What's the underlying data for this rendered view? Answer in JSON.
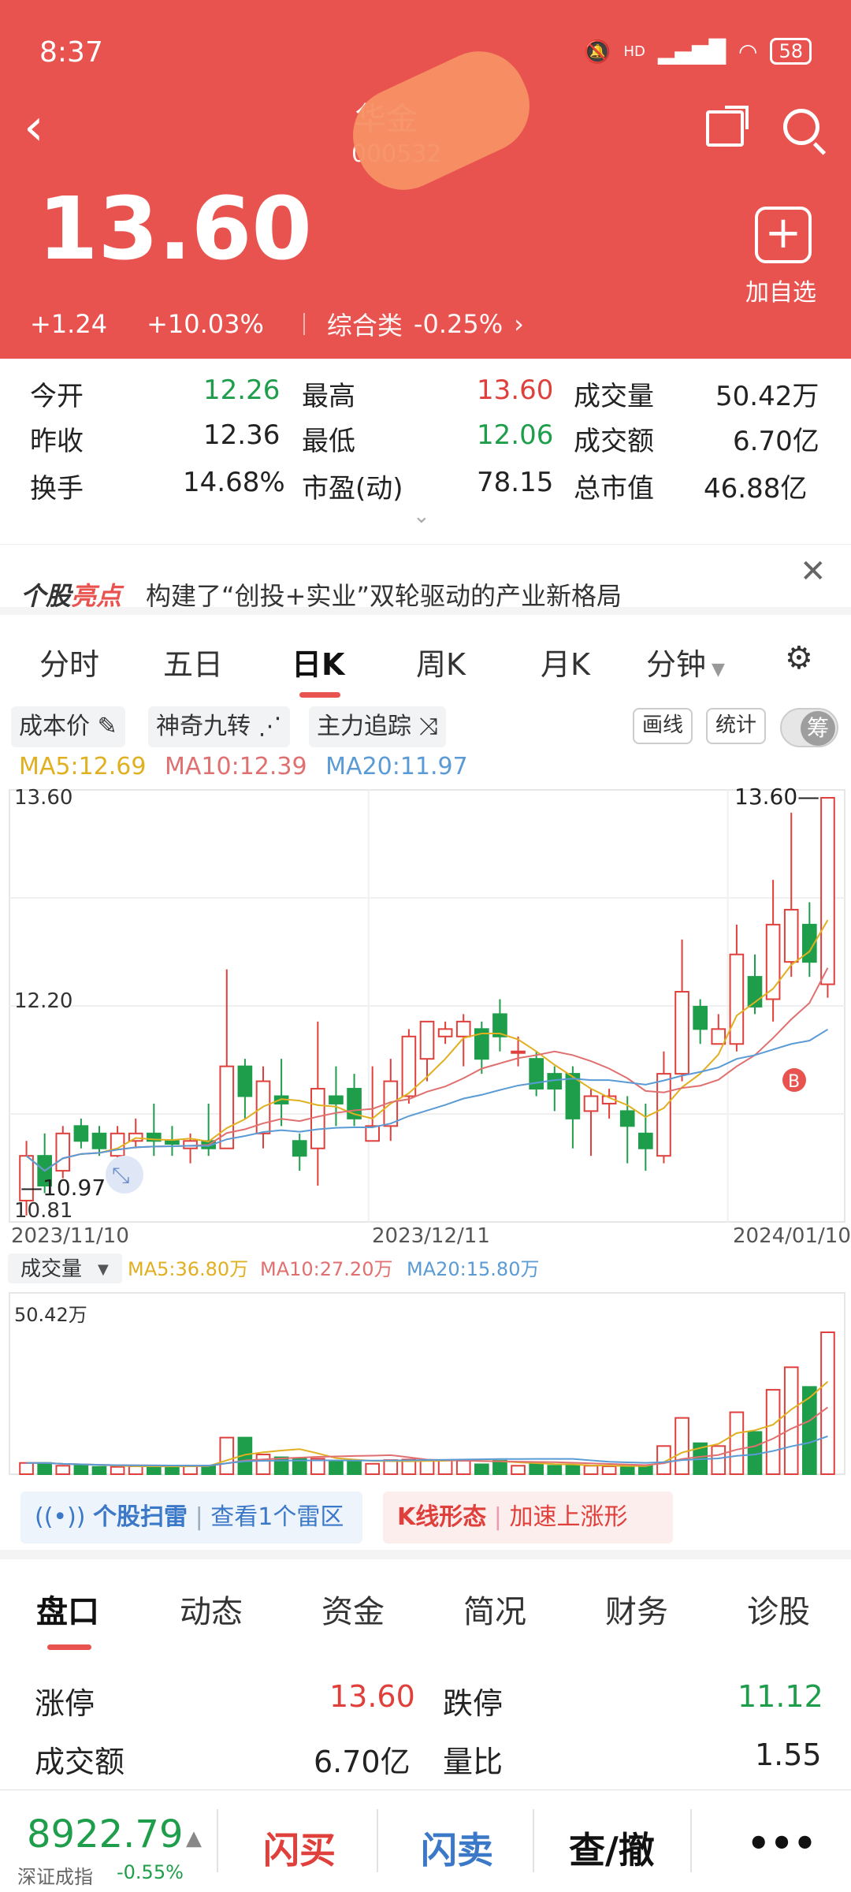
{
  "status": {
    "time": "8:37",
    "battery": "58",
    "hd": "HD"
  },
  "header": {
    "name": "华金",
    "code": "000532",
    "price": "13.60",
    "change": "+1.24",
    "change_pct": "+10.03%",
    "sector": "综合类",
    "sector_pct": "-0.25%",
    "add_label": "加自选"
  },
  "quotes": [
    [
      {
        "label": "今开",
        "value": "12.26",
        "color": "green"
      },
      {
        "label": "最高",
        "value": "13.60",
        "color": "red"
      },
      {
        "label": "成交量",
        "value": "50.42万",
        "color": "dark"
      }
    ],
    [
      {
        "label": "昨收",
        "value": "12.36",
        "color": "dark"
      },
      {
        "label": "最低",
        "value": "12.06",
        "color": "green"
      },
      {
        "label": "成交额",
        "value": "6.70亿",
        "color": "dark"
      }
    ],
    [
      {
        "label": "换手",
        "value": "14.68%",
        "color": "dark"
      },
      {
        "label": "市盈(动)",
        "value": "78.15",
        "color": "dark"
      },
      {
        "label": "总市值",
        "value": "46.88亿",
        "color": "dark"
      }
    ]
  ],
  "news": {
    "tag_a": "个股",
    "tag_b": "亮点",
    "text": "构建了“创投+实业”双轮驱动的产业新格局"
  },
  "chart_tabs": [
    "分时",
    "五日",
    "日K",
    "周K",
    "月K",
    "分钟"
  ],
  "tools": {
    "cost": "成本价",
    "nine": "神奇九转",
    "track": "主力追踪",
    "draw": "画线",
    "stat": "统计",
    "chip": "筹"
  },
  "ma": {
    "ma5": "MA5:12.69",
    "ma10": "MA10:12.39",
    "ma20": "MA20:11.97"
  },
  "colors": {
    "up": "#e0403c",
    "down": "#1e9e4a",
    "ma5": "#e0b020",
    "ma10": "#e07070",
    "ma20": "#5a9bd5",
    "header": "#e9534f"
  },
  "chart_data": {
    "type": "candlestick",
    "price_labels": {
      "top": "13.60",
      "mid": "12.20",
      "bottom": "10.81",
      "low_mark": "10.97",
      "high_mark": "13.60"
    },
    "ylim": [
      10.81,
      13.6
    ],
    "dates": [
      "2023/11/10",
      "2023/12/11",
      "2024/01/10"
    ],
    "candles": [
      [
        10.9,
        11.2,
        11.3,
        10.8
      ],
      [
        11.2,
        11.0,
        11.35,
        10.95
      ],
      [
        11.1,
        11.35,
        11.4,
        11.05
      ],
      [
        11.4,
        11.3,
        11.45,
        11.25
      ],
      [
        11.35,
        11.25,
        11.4,
        11.2
      ],
      [
        11.2,
        11.35,
        11.4,
        11.15
      ],
      [
        11.3,
        11.35,
        11.45,
        11.25
      ],
      [
        11.35,
        11.3,
        11.55,
        11.2
      ],
      [
        11.3,
        11.28,
        11.4,
        11.2
      ],
      [
        11.25,
        11.3,
        11.35,
        11.15
      ],
      [
        11.3,
        11.25,
        11.55,
        11.2
      ],
      [
        11.25,
        11.8,
        12.45,
        11.25
      ],
      [
        11.8,
        11.6,
        11.85,
        11.45
      ],
      [
        11.35,
        11.7,
        11.8,
        11.25
      ],
      [
        11.6,
        11.55,
        11.85,
        11.4
      ],
      [
        11.3,
        11.2,
        11.35,
        11.1
      ],
      [
        11.25,
        11.65,
        12.1,
        11.0
      ],
      [
        11.6,
        11.55,
        11.8,
        11.4
      ],
      [
        11.65,
        11.45,
        11.75,
        11.4
      ],
      [
        11.3,
        11.4,
        11.8,
        11.3
      ],
      [
        11.4,
        11.7,
        11.85,
        11.3
      ],
      [
        11.6,
        12.0,
        12.05,
        11.55
      ],
      [
        11.85,
        12.1,
        12.1,
        11.7
      ],
      [
        12.0,
        12.05,
        12.1,
        11.95
      ],
      [
        12.0,
        12.1,
        12.15,
        11.8
      ],
      [
        12.05,
        11.85,
        12.1,
        11.75
      ],
      [
        12.15,
        12.0,
        12.25,
        11.9
      ],
      [
        11.9,
        11.9,
        12.0,
        11.8
      ],
      [
        11.85,
        11.65,
        11.9,
        11.6
      ],
      [
        11.75,
        11.65,
        11.8,
        11.5
      ],
      [
        11.75,
        11.45,
        11.8,
        11.25
      ],
      [
        11.5,
        11.6,
        11.65,
        11.2
      ],
      [
        11.55,
        11.6,
        11.65,
        11.45
      ],
      [
        11.5,
        11.4,
        11.6,
        11.15
      ],
      [
        11.35,
        11.25,
        11.55,
        11.1
      ],
      [
        11.2,
        11.75,
        11.9,
        11.15
      ],
      [
        11.75,
        12.3,
        12.65,
        11.7
      ],
      [
        12.2,
        12.05,
        12.25,
        11.95
      ],
      [
        11.95,
        12.05,
        12.15,
        11.95
      ],
      [
        11.95,
        12.55,
        12.75,
        11.9
      ],
      [
        12.4,
        12.2,
        12.55,
        12.15
      ],
      [
        12.25,
        12.75,
        13.05,
        12.1
      ],
      [
        12.5,
        12.85,
        13.5,
        12.4
      ],
      [
        12.75,
        12.5,
        12.9,
        12.4
      ],
      [
        12.35,
        13.6,
        13.6,
        12.26
      ]
    ]
  },
  "volume": {
    "label": "成交量",
    "ma5": "MA5:36.80万",
    "ma10": "MA10:27.20万",
    "ma20": "MA20:15.80万",
    "top": "50.42万",
    "values": [
      4,
      4,
      3,
      3,
      2.6,
      2.6,
      2.8,
      3,
      2.8,
      2.8,
      3,
      13,
      13,
      7,
      6,
      5.5,
      5.5,
      4.5,
      4.5,
      3.7,
      5,
      5.2,
      5,
      4.9,
      4.8,
      3.5,
      4.8,
      3,
      3.5,
      3,
      3,
      3,
      2.8,
      2.8,
      2.8,
      10,
      20,
      11,
      10,
      22,
      15,
      30,
      38,
      31,
      50.42
    ]
  },
  "scan": {
    "a_title": "个股扫雷",
    "a_text": "查看1个雷区",
    "b_title": "K线形态",
    "b_text": "加速上涨形"
  },
  "bottom_tabs": [
    "盘口",
    "动态",
    "资金",
    "简况",
    "财务",
    "诊股"
  ],
  "handicap": [
    {
      "label": "涨停",
      "value": "13.60",
      "color": "red"
    },
    {
      "label": "跌停",
      "value": "11.12",
      "color": "green"
    },
    {
      "label": "成交额",
      "value": "6.70亿",
      "color": "dark"
    },
    {
      "label": "量比",
      "value": "1.55",
      "color": "dark"
    }
  ],
  "footer": {
    "index_value": "8922.79",
    "index_name": "深证成指",
    "index_chg": "-0.55%",
    "buy": "闪买",
    "sell": "闪卖",
    "query": "查/撤",
    "more": "•••"
  }
}
